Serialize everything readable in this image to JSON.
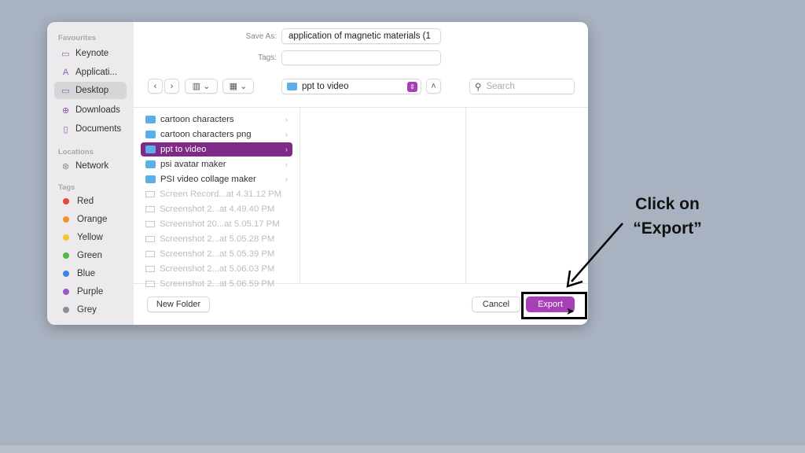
{
  "sidebar": {
    "favourites_header": "Favourites",
    "favourites": [
      {
        "label": "Keynote",
        "icon": "folder-icon"
      },
      {
        "label": "Applicati...",
        "icon": "applications-icon"
      },
      {
        "label": "Desktop",
        "icon": "desktop-icon",
        "selected": true
      },
      {
        "label": "Downloads",
        "icon": "download-icon"
      },
      {
        "label": "Documents",
        "icon": "document-icon"
      }
    ],
    "locations_header": "Locations",
    "locations": [
      {
        "label": "Network",
        "icon": "network-icon"
      }
    ],
    "tags_header": "Tags",
    "tags": [
      {
        "label": "Red",
        "color": "#e5483f"
      },
      {
        "label": "Orange",
        "color": "#f0912e"
      },
      {
        "label": "Yellow",
        "color": "#f3c433"
      },
      {
        "label": "Green",
        "color": "#52b848"
      },
      {
        "label": "Blue",
        "color": "#3a86e8"
      },
      {
        "label": "Purple",
        "color": "#9c58c9"
      },
      {
        "label": "Grey",
        "color": "#8e8e93"
      }
    ]
  },
  "form": {
    "save_as_label": "Save As:",
    "save_as_value": "application of magnetic materials (1",
    "tags_label": "Tags:",
    "tags_value": ""
  },
  "toolbar": {
    "location": "ppt to video",
    "search_placeholder": "Search"
  },
  "files": [
    {
      "name": "cartoon characters",
      "type": "folder"
    },
    {
      "name": "cartoon characters png",
      "type": "folder"
    },
    {
      "name": "ppt to video",
      "type": "folder",
      "selected": true
    },
    {
      "name": "psi avatar maker",
      "type": "folder"
    },
    {
      "name": "PSI video collage maker",
      "type": "folder"
    },
    {
      "name": "Screen Record...at 4.31.12 PM",
      "type": "file"
    },
    {
      "name": "Screenshot 2...at 4.49.40 PM",
      "type": "file"
    },
    {
      "name": "Screenshot 20...at 5.05.17 PM",
      "type": "file"
    },
    {
      "name": "Screenshot 2...at 5.05.28 PM",
      "type": "file"
    },
    {
      "name": "Screenshot 2...at 5.05.39 PM",
      "type": "file"
    },
    {
      "name": "Screenshot 2...at 5.06.03 PM",
      "type": "file"
    },
    {
      "name": "Screenshot 2...at 5.06.59 PM",
      "type": "file"
    }
  ],
  "footer": {
    "new_folder": "New Folder",
    "cancel": "Cancel",
    "export": "Export"
  },
  "accent": "#a73fb6",
  "annotation": {
    "line1": "Click on",
    "line2": "“Export”"
  }
}
